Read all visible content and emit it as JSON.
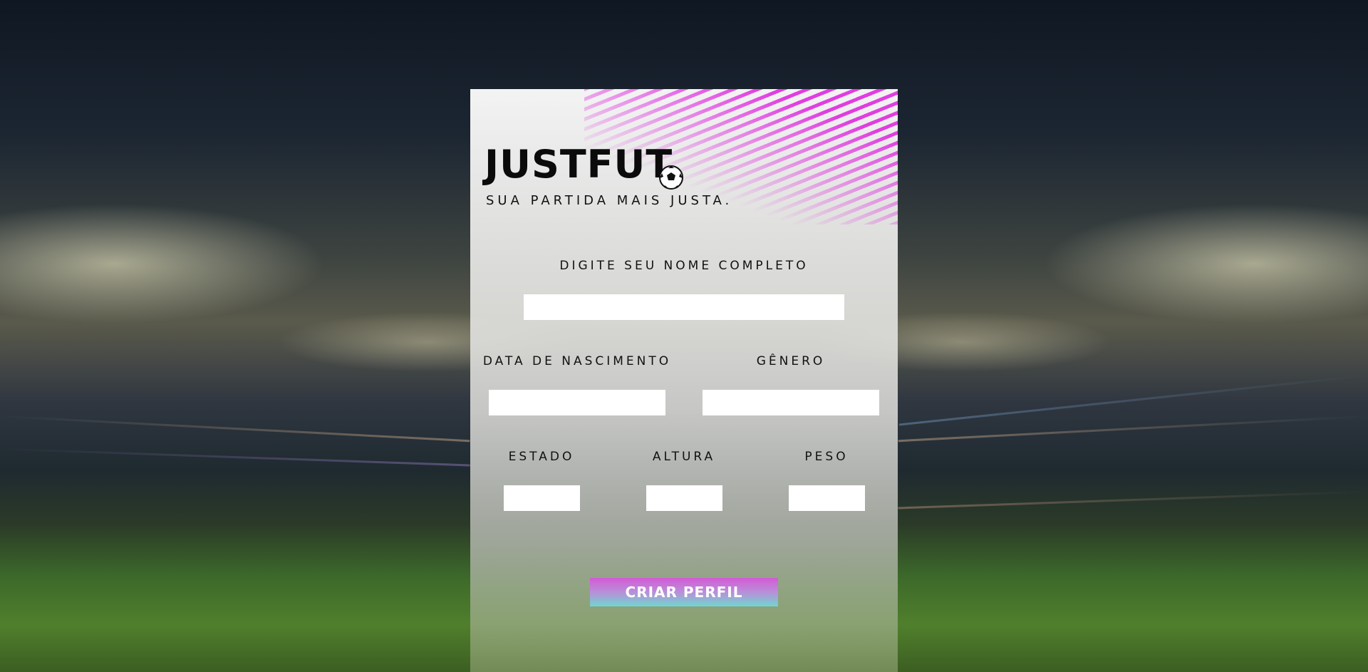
{
  "brand": {
    "title": "JUSTFUT",
    "tagline": "SUA PARTIDA MAIS JUSTA."
  },
  "form": {
    "full_name": {
      "label": "DIGITE SEU NOME COMPLETO",
      "value": ""
    },
    "birth_date": {
      "label": "DATA DE NASCIMENTO",
      "value": ""
    },
    "gender": {
      "label": "GÊNERO",
      "value": ""
    },
    "state": {
      "label": "ESTADO",
      "value": ""
    },
    "height": {
      "label": "ALTURA",
      "value": ""
    },
    "weight": {
      "label": "PESO",
      "value": ""
    },
    "submit_label": "CRIAR PERFIL"
  },
  "colors": {
    "accent_pink": "#e03ee0",
    "button_top": "#d45ad6",
    "button_bottom": "#6fd6cf"
  },
  "icons": {
    "ball": "soccer-ball-icon"
  }
}
